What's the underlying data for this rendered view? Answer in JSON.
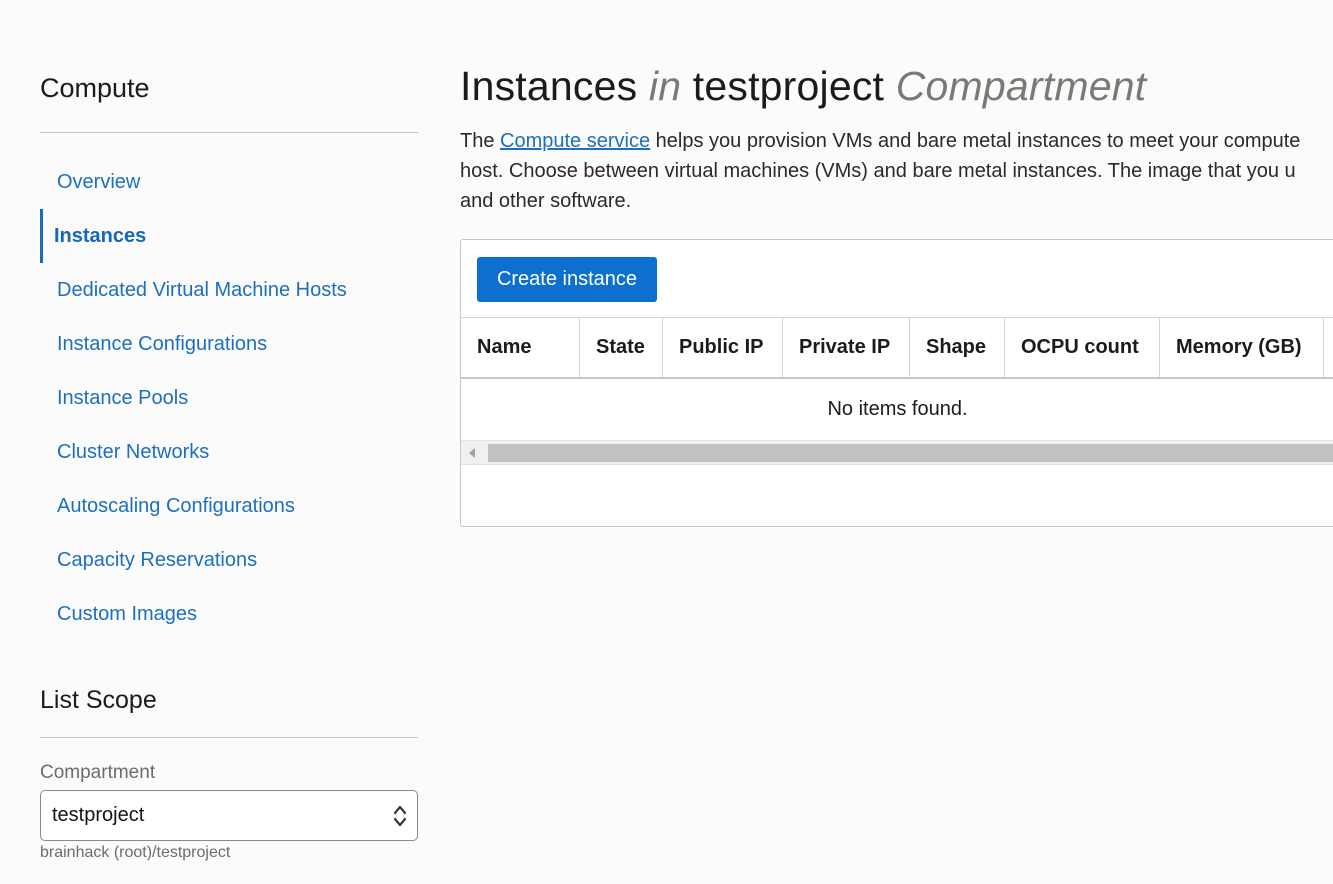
{
  "sidebar": {
    "title": "Compute",
    "items": [
      {
        "label": "Overview",
        "active": false
      },
      {
        "label": "Instances",
        "active": true
      },
      {
        "label": "Dedicated Virtual Machine Hosts",
        "active": false
      },
      {
        "label": "Instance Configurations",
        "active": false
      },
      {
        "label": "Instance Pools",
        "active": false
      },
      {
        "label": "Cluster Networks",
        "active": false
      },
      {
        "label": "Autoscaling Configurations",
        "active": false
      },
      {
        "label": "Capacity Reservations",
        "active": false
      },
      {
        "label": "Custom Images",
        "active": false
      }
    ],
    "list_scope": {
      "title": "List Scope",
      "compartment_label": "Compartment",
      "compartment_value": "testproject",
      "compartment_path": "brainhack (root)/testproject"
    }
  },
  "main": {
    "title": {
      "part1": "Instances",
      "part2": "in",
      "part3": "testproject",
      "part4": "Compartment"
    },
    "description": {
      "prefix": "The",
      "link": "Compute service",
      "line1_rest": "helps you provision VMs and bare metal instances to meet your compute",
      "line2": "host. Choose between virtual machines (VMs) and bare metal instances. The image that you u",
      "line3": "and other software."
    },
    "create_button": "Create instance",
    "table": {
      "columns": [
        "Name",
        "State",
        "Public IP",
        "Private IP",
        "Shape",
        "OCPU count",
        "Memory (GB)"
      ],
      "empty_message": "No items found."
    }
  },
  "colors": {
    "link": "#1d6fbf",
    "primary_button": "#0d6fd0",
    "active_nav_border": "#1b6bbd"
  }
}
